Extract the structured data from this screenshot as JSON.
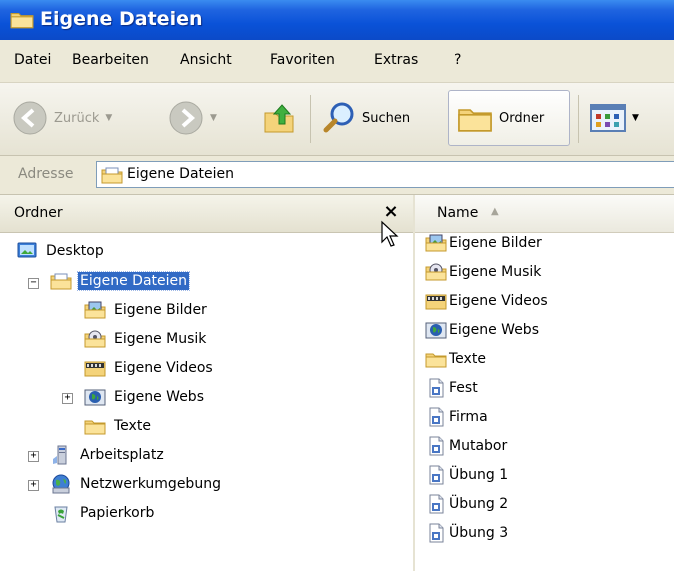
{
  "window": {
    "title": "Eigene Dateien"
  },
  "menu": [
    "Datei",
    "Bearbeiten",
    "Ansicht",
    "Favoriten",
    "Extras",
    "?"
  ],
  "toolbar": {
    "back": "Zurück",
    "search": "Suchen",
    "folders": "Ordner"
  },
  "address": {
    "label": "Adresse",
    "value": "Eigene Dateien"
  },
  "folders_pane": {
    "title": "Ordner",
    "close": "×",
    "tree": [
      {
        "label": "Desktop",
        "icon": "desktop-icon"
      },
      {
        "label": "Eigene Dateien",
        "icon": "my-documents-icon",
        "selected": true,
        "expander": "−"
      },
      {
        "label": "Eigene Bilder",
        "icon": "my-pictures-icon"
      },
      {
        "label": "Eigene Musik",
        "icon": "my-music-icon"
      },
      {
        "label": "Eigene Videos",
        "icon": "my-videos-icon"
      },
      {
        "label": "Eigene Webs",
        "icon": "my-webs-icon",
        "expander": "+"
      },
      {
        "label": "Texte",
        "icon": "folder-icon"
      },
      {
        "label": "Arbeitsplatz",
        "icon": "my-computer-icon",
        "expander": "+"
      },
      {
        "label": "Netzwerkumgebung",
        "icon": "network-icon",
        "expander": "+"
      },
      {
        "label": "Papierkorb",
        "icon": "recycle-bin-icon"
      }
    ]
  },
  "file_list": {
    "column_name": "Name",
    "sort_indicator": "▲",
    "items": [
      {
        "label": "Eigene Bilder",
        "icon": "my-pictures-icon"
      },
      {
        "label": "Eigene Musik",
        "icon": "my-music-icon"
      },
      {
        "label": "Eigene Videos",
        "icon": "my-videos-icon"
      },
      {
        "label": "Eigene Webs",
        "icon": "my-webs-icon"
      },
      {
        "label": "Texte",
        "icon": "folder-icon"
      },
      {
        "label": "Fest",
        "icon": "document-icon"
      },
      {
        "label": "Firma",
        "icon": "document-icon"
      },
      {
        "label": "Mutabor",
        "icon": "document-icon"
      },
      {
        "label": "Übung 1",
        "icon": "document-icon"
      },
      {
        "label": "Übung 2",
        "icon": "document-icon"
      },
      {
        "label": "Übung 3",
        "icon": "document-icon"
      }
    ]
  },
  "colors": {
    "titlebar": "#0a52d8",
    "selection": "#316ac5",
    "chrome": "#ece9d8"
  }
}
